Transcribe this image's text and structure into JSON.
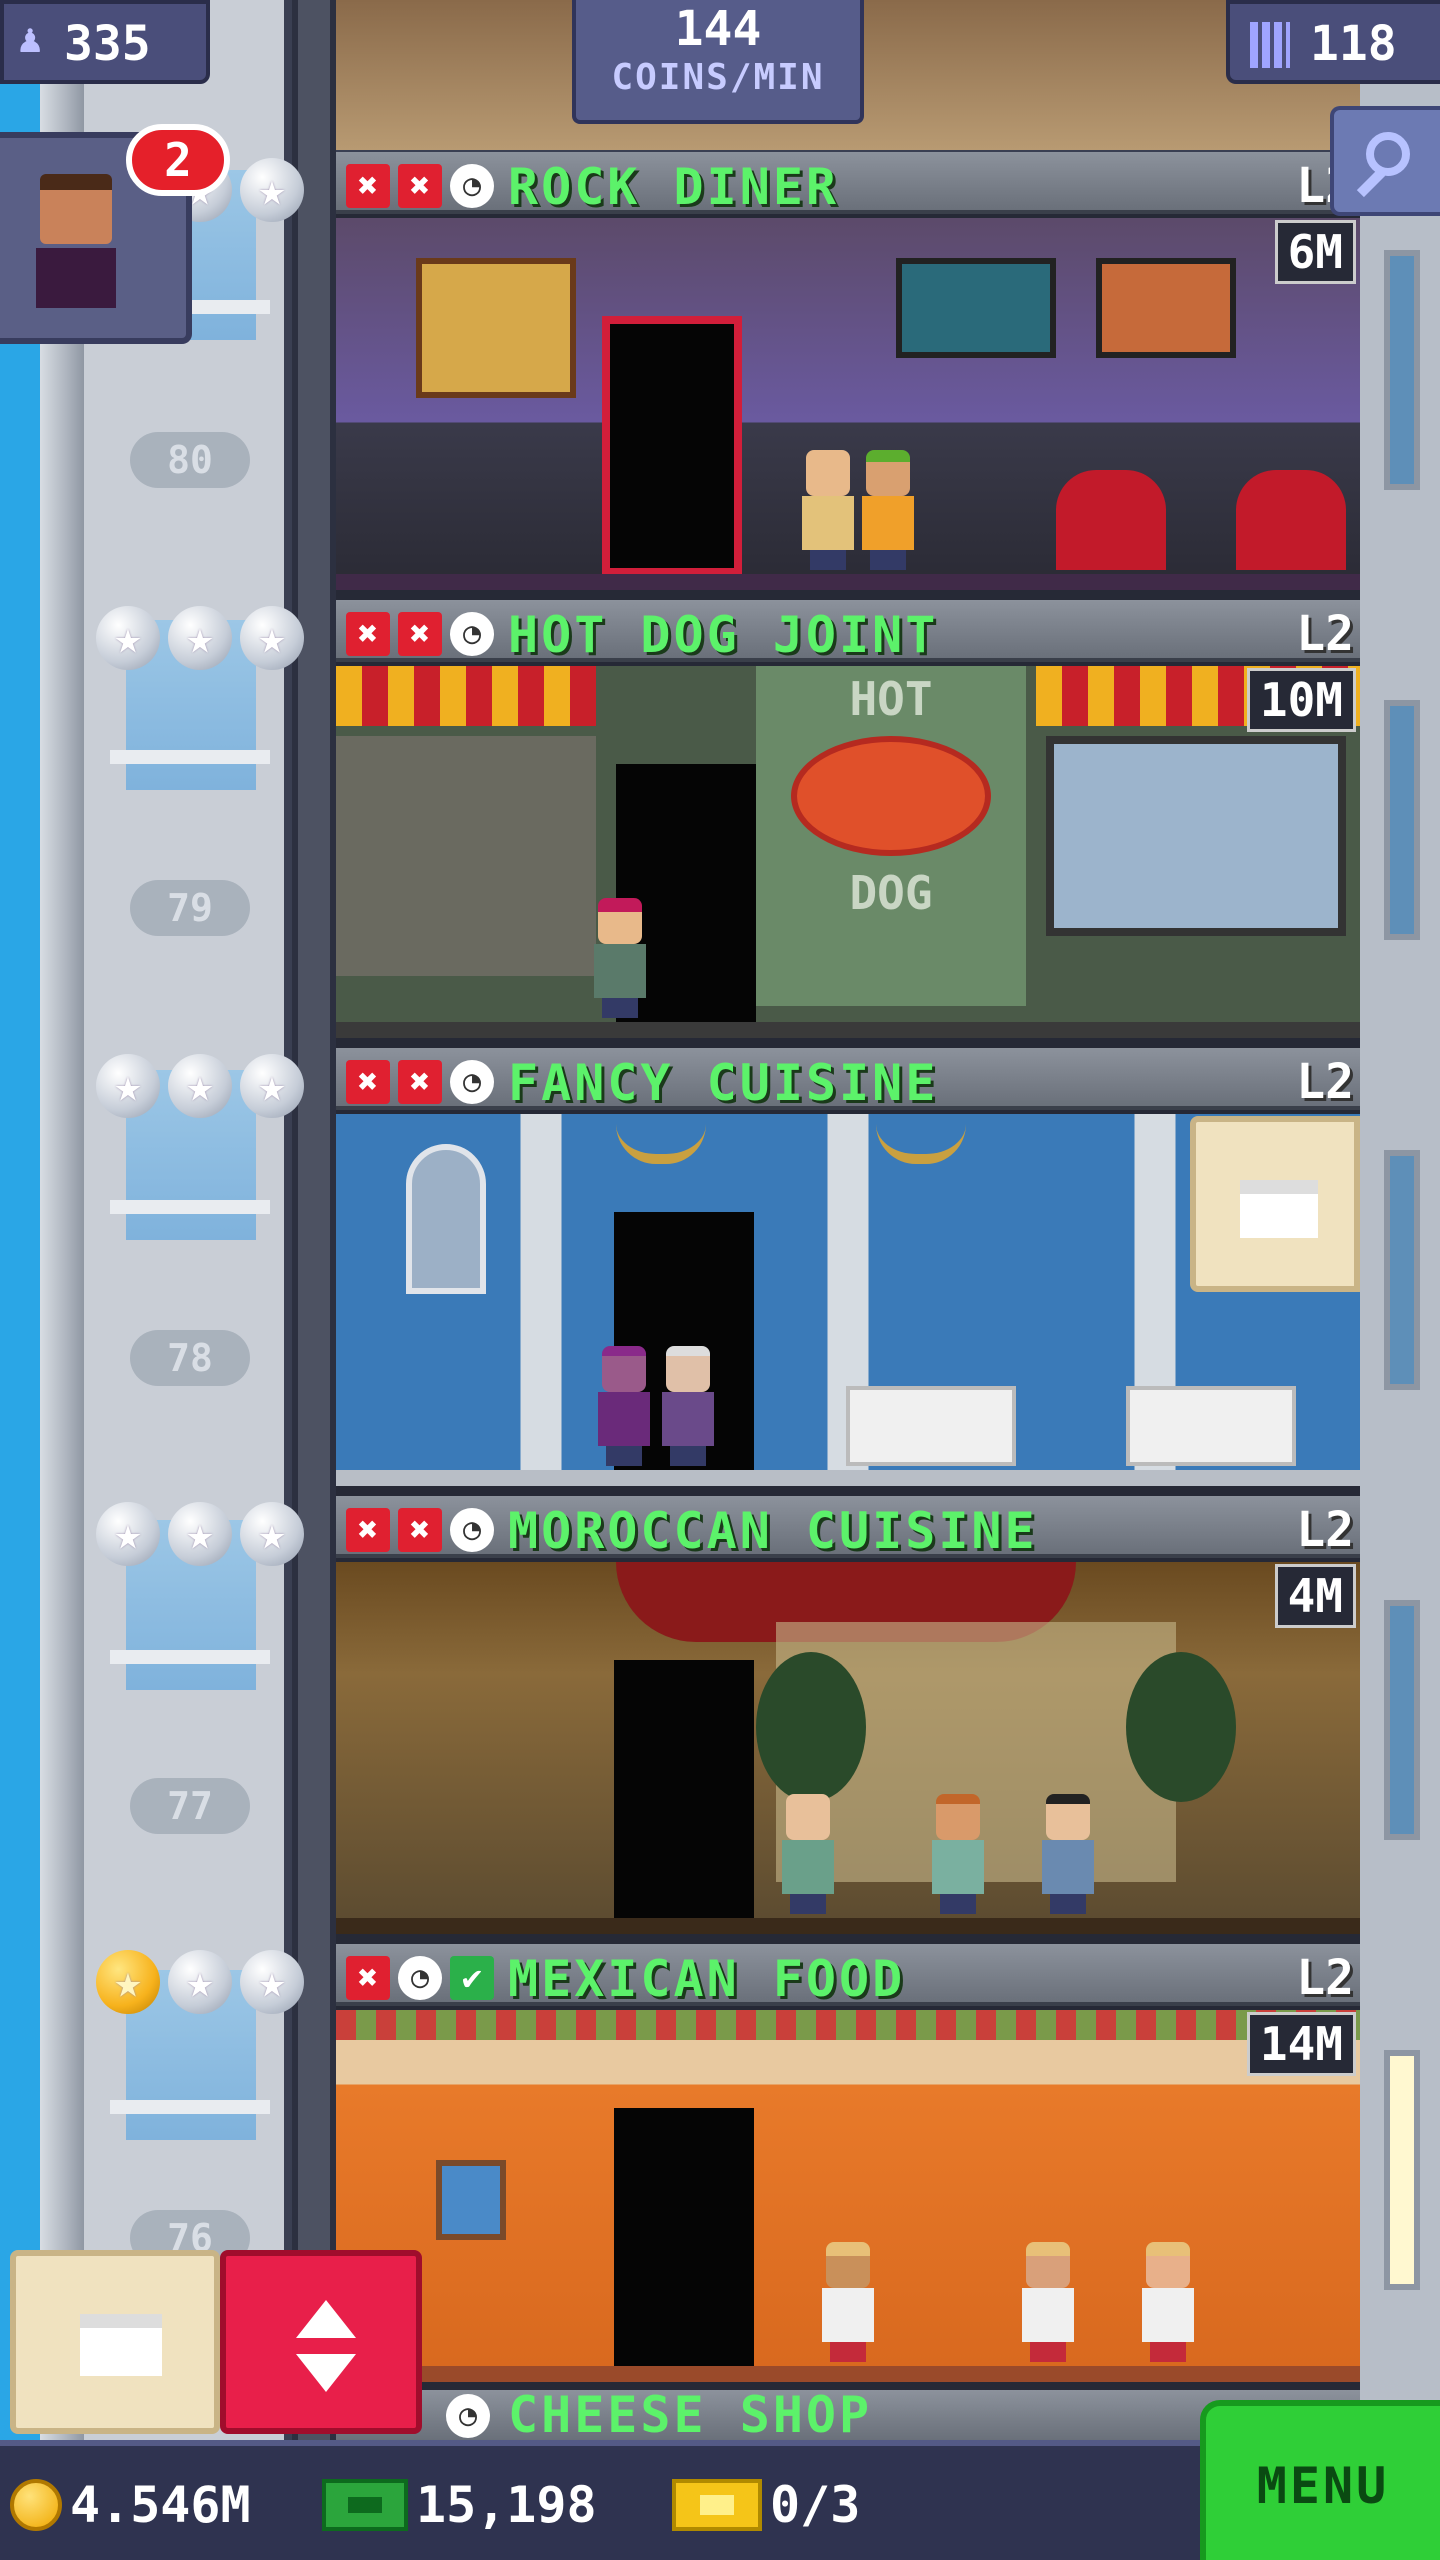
{
  "header": {
    "population": "335",
    "population_icon": "person-icon",
    "coins_per_min_value": "144",
    "coins_per_min_label": "COINS/MIN",
    "floors_count": "118",
    "floors_icon": "building-icon"
  },
  "visitor": {
    "badge_count": "2"
  },
  "floors": [
    {
      "name": "ROCK DINER",
      "level": "L2",
      "timer": "6M",
      "floor_number": "80",
      "stars": [
        false,
        false,
        false
      ],
      "statuses": [
        "x",
        "x",
        "clock"
      ]
    },
    {
      "name": "HOT DOG JOINT",
      "level": "L2",
      "timer": "10M",
      "floor_number": "79",
      "stars": [
        false,
        false,
        false
      ],
      "statuses": [
        "x",
        "x",
        "clock"
      ]
    },
    {
      "name": "FANCY CUISINE",
      "level": "L2",
      "timer": "",
      "floor_number": "78",
      "stars": [
        false,
        false,
        false
      ],
      "statuses": [
        "x",
        "x",
        "clock"
      ]
    },
    {
      "name": "MOROCCAN CUISINE",
      "level": "L2",
      "timer": "4M",
      "floor_number": "77",
      "stars": [
        false,
        false,
        false
      ],
      "statuses": [
        "x",
        "x",
        "clock"
      ]
    },
    {
      "name": "MEXICAN FOOD",
      "level": "L2",
      "timer": "14M",
      "floor_number": "76",
      "stars": [
        true,
        false,
        false
      ],
      "statuses": [
        "x",
        "clock",
        "check"
      ]
    }
  ],
  "hot_dog_sign": {
    "top": "HOT",
    "bottom": "DOG"
  },
  "next_floor": {
    "name": "CHEESE SHOP"
  },
  "bottom": {
    "coins": "4.546M",
    "bux": "15,198",
    "tickets": "0/3",
    "menu_label": "MENU"
  },
  "colors": {
    "floor_name": "#5cf26a",
    "menu_button": "#2fcf37",
    "elevator_button": "#e81f4a",
    "badge": "#e5202a",
    "sky": "#2aa6e6"
  }
}
